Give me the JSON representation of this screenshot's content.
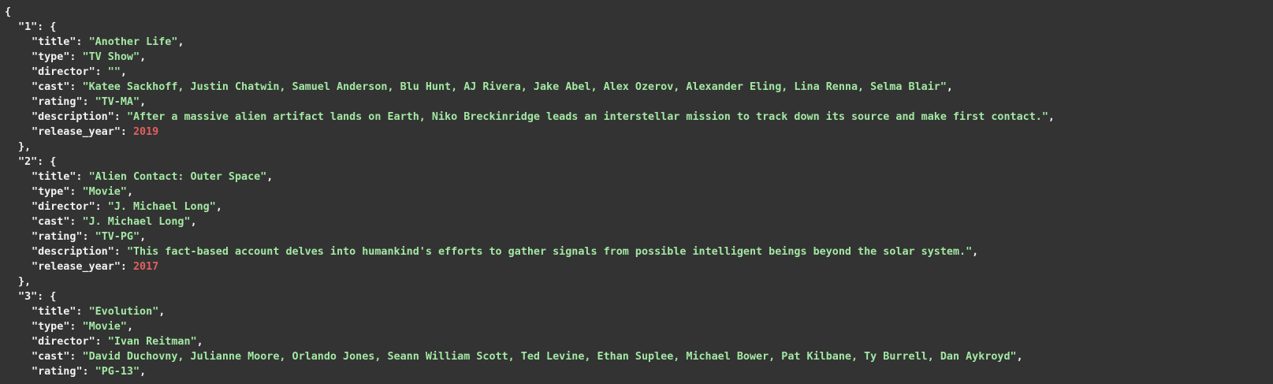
{
  "records": [
    {
      "id": "1",
      "fields": [
        {
          "key": "title",
          "value": "Another Life",
          "kind": "string"
        },
        {
          "key": "type",
          "value": "TV Show",
          "kind": "string"
        },
        {
          "key": "director",
          "value": "",
          "kind": "string"
        },
        {
          "key": "cast",
          "value": "Katee Sackhoff, Justin Chatwin, Samuel Anderson, Blu Hunt, AJ Rivera, Jake Abel, Alex Ozerov, Alexander Eling, Lina Renna, Selma Blair",
          "kind": "string"
        },
        {
          "key": "rating",
          "value": "TV-MA",
          "kind": "string"
        },
        {
          "key": "description",
          "value": "After a massive alien artifact lands on Earth, Niko Breckinridge leads an interstellar mission to track down its source and make first contact.",
          "kind": "string"
        },
        {
          "key": "release_year",
          "value": "2019",
          "kind": "number"
        }
      ]
    },
    {
      "id": "2",
      "fields": [
        {
          "key": "title",
          "value": "Alien Contact: Outer Space",
          "kind": "string"
        },
        {
          "key": "type",
          "value": "Movie",
          "kind": "string"
        },
        {
          "key": "director",
          "value": "J. Michael Long",
          "kind": "string"
        },
        {
          "key": "cast",
          "value": "J. Michael Long",
          "kind": "string"
        },
        {
          "key": "rating",
          "value": "TV-PG",
          "kind": "string"
        },
        {
          "key": "description",
          "value": "This fact-based account delves into humankind's efforts to gather signals from possible intelligent beings beyond the solar system.",
          "kind": "string"
        },
        {
          "key": "release_year",
          "value": "2017",
          "kind": "number"
        }
      ]
    },
    {
      "id": "3",
      "fields": [
        {
          "key": "title",
          "value": "Evolution",
          "kind": "string"
        },
        {
          "key": "type",
          "value": "Movie",
          "kind": "string"
        },
        {
          "key": "director",
          "value": "Ivan Reitman",
          "kind": "string"
        },
        {
          "key": "cast",
          "value": "David Duchovny, Julianne Moore, Orlando Jones, Seann William Scott, Ted Levine, Ethan Suplee, Michael Bower, Pat Kilbane, Ty Burrell, Dan Aykroyd",
          "kind": "string"
        },
        {
          "key": "rating",
          "value": "PG-13",
          "kind": "string"
        }
      ]
    }
  ],
  "colors": {
    "background": "#333333",
    "key": "#f2f2f2",
    "string": "#a3e8a3",
    "number": "#e45f5f"
  }
}
